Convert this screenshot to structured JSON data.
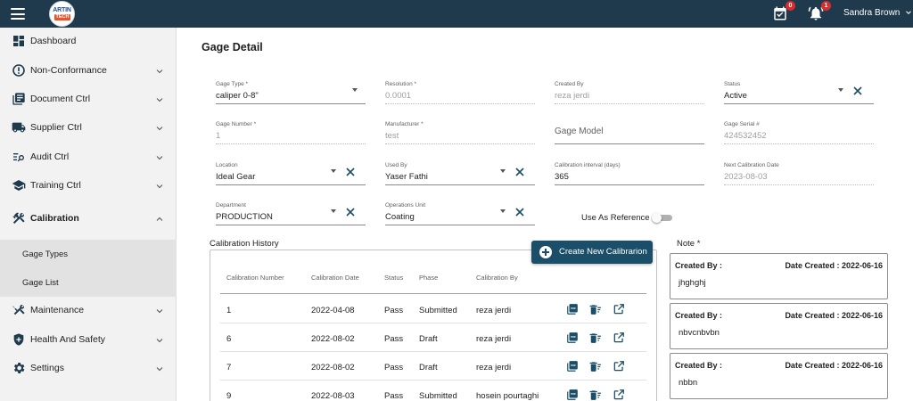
{
  "app": {
    "logo_top": "ARTIN",
    "logo_bottom": "TECH"
  },
  "header": {
    "calendar_badge": "0",
    "notification_badge": "1",
    "user_name": "Sandra Brown"
  },
  "sidebar": {
    "items": [
      {
        "label": "Dashboard",
        "icon": "dashboard-icon"
      },
      {
        "label": "Non-Conformance",
        "icon": "alert-circle-icon"
      },
      {
        "label": "Document Ctrl",
        "icon": "documents-icon"
      },
      {
        "label": "Supplier Ctrl",
        "icon": "truck-icon"
      },
      {
        "label": "Audit Ctrl",
        "icon": "list-search-icon"
      },
      {
        "label": "Training Ctrl",
        "icon": "graduation-cap-icon"
      },
      {
        "label": "Calibration",
        "icon": "tools-icon"
      },
      {
        "label": "Maintenance",
        "icon": "maintenance-icon"
      },
      {
        "label": "Health And Safety",
        "icon": "shield-icon"
      },
      {
        "label": "Settings",
        "icon": "gear-icon"
      }
    ],
    "subitems": [
      "Gage Types",
      "Gage List"
    ]
  },
  "page": {
    "title": "Gage Detail"
  },
  "form": {
    "gage_type": {
      "label": "Gage Type *",
      "value": "caliper 0-8\""
    },
    "resolution": {
      "label": "Resolution *",
      "value": "0.0001"
    },
    "created_by": {
      "label": "Created By",
      "value": "reza jerdi"
    },
    "status": {
      "label": "Status",
      "value": "Active"
    },
    "gage_number": {
      "label": "Gage Number *",
      "value": "1"
    },
    "manufacturer": {
      "label": "Manufacturer *",
      "value": "test"
    },
    "gage_model": {
      "placeholder": "Gage Model"
    },
    "gage_serial": {
      "label": "Gage Serial #",
      "value": "424532452"
    },
    "location": {
      "label": "Location",
      "value": "Ideal Gear"
    },
    "used_by": {
      "label": "Used By",
      "value": "Yaser Fathi"
    },
    "calibration_interval": {
      "label": "Calibration interval (days)",
      "value": "365"
    },
    "next_calibration_date": {
      "label": "Next Calibration Date",
      "value": "2023-08-03"
    },
    "department": {
      "label": "Department",
      "value": "PRODUCTION"
    },
    "operations_unit": {
      "label": "Operations Unit",
      "value": "Coating"
    },
    "use_as_reference": {
      "label": "Use As Reference",
      "checked": false
    }
  },
  "history": {
    "title": "Calibration History",
    "create_button": "Create New Calibrarion",
    "columns": [
      "Calibration Number",
      "Calibration Date",
      "Status",
      "Phase",
      "Calibration By"
    ],
    "rows": [
      {
        "number": "1",
        "date": "2022-04-08",
        "status": "Pass",
        "phase": "Submitted",
        "by": "reza jerdi"
      },
      {
        "number": "6",
        "date": "2022-08-02",
        "status": "Pass",
        "phase": "Draft",
        "by": "reza jerdi"
      },
      {
        "number": "7",
        "date": "2022-08-02",
        "status": "Pass",
        "phase": "Draft",
        "by": "reza jerdi"
      },
      {
        "number": "9",
        "date": "2022-08-03",
        "status": "Pass",
        "phase": "Submitted",
        "by": "hosein pourtaghi"
      }
    ]
  },
  "notes": {
    "title": "Note *",
    "items": [
      {
        "created_by_label": "Created By :",
        "date_label": "Date Created : 2022-06-16",
        "text": "jhghghj"
      },
      {
        "created_by_label": "Created By :",
        "date_label": "Date Created : 2022-06-16",
        "text": "nbvcnbvbn"
      },
      {
        "created_by_label": "Created By :",
        "date_label": "Date Created : 2022-06-16",
        "text": "nbbn"
      }
    ]
  },
  "colors": {
    "topbar": "#1e3a4c",
    "primary_button": "#1b4e68",
    "badge": "#d32f2f",
    "action_icon": "#1b4e68"
  }
}
